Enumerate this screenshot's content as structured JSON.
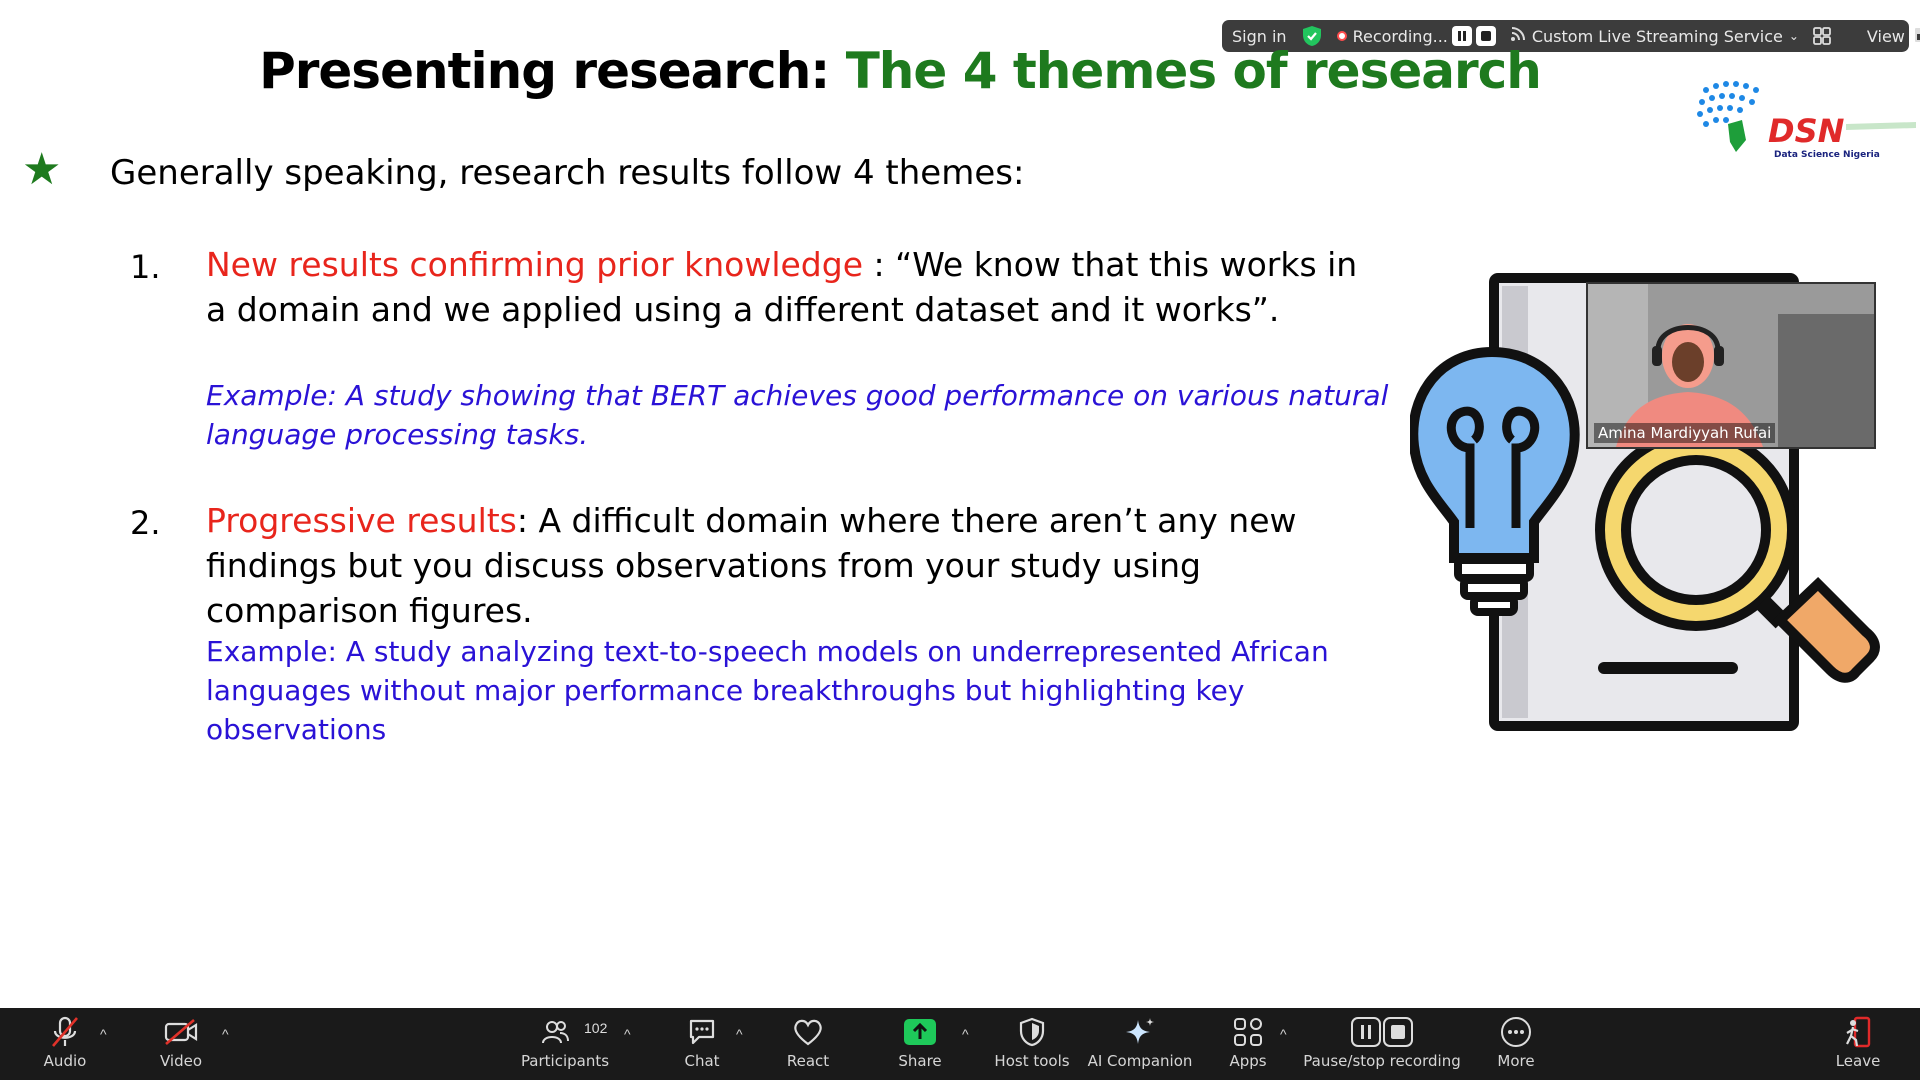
{
  "topbar": {
    "sign_in": "Sign in",
    "recording_label": "Recording...",
    "streaming_label": "Custom Live Streaming Service",
    "view_label": "View"
  },
  "slide": {
    "title_black": "Presenting research: ",
    "title_green": "The 4 themes of research",
    "intro": "Generally speaking, research results follow 4 themes:",
    "item1": {
      "number": "1.",
      "highlight": "New results confirming prior knowledge",
      "text": " : “We know that this works in a domain and we applied using a different dataset and it works”.",
      "example": "Example: A study showing that BERT achieves good performance on various natural language processing tasks."
    },
    "item2": {
      "number": "2.",
      "highlight": "Progressive results",
      "text": ": A difficult domain where there aren’t any new findings but you discuss observations from your study using comparison figures.",
      "example": "Example: A study analyzing text-to-speech models on underrepresented African languages without major performance breakthroughs but highlighting key observations"
    },
    "logo": {
      "brand": "DSN",
      "subtitle": "Data Science Nigeria"
    }
  },
  "webcam": {
    "participant_name": "Amina Mardiyyah Rufai"
  },
  "toolbar": {
    "audio": "Audio",
    "video": "Video",
    "participants": "Participants",
    "participants_count": "102",
    "chat": "Chat",
    "react": "React",
    "share": "Share",
    "host_tools": "Host tools",
    "ai_companion": "AI Companion",
    "apps": "Apps",
    "pause_stop_recording": "Pause/stop recording",
    "more": "More",
    "leave": "Leave"
  },
  "colors": {
    "title_green": "#1e7a1e",
    "highlight_red": "#e8251c",
    "example_blue": "#2a12d6",
    "share_green": "#1ec95a",
    "leave_red": "#e02a2a"
  }
}
